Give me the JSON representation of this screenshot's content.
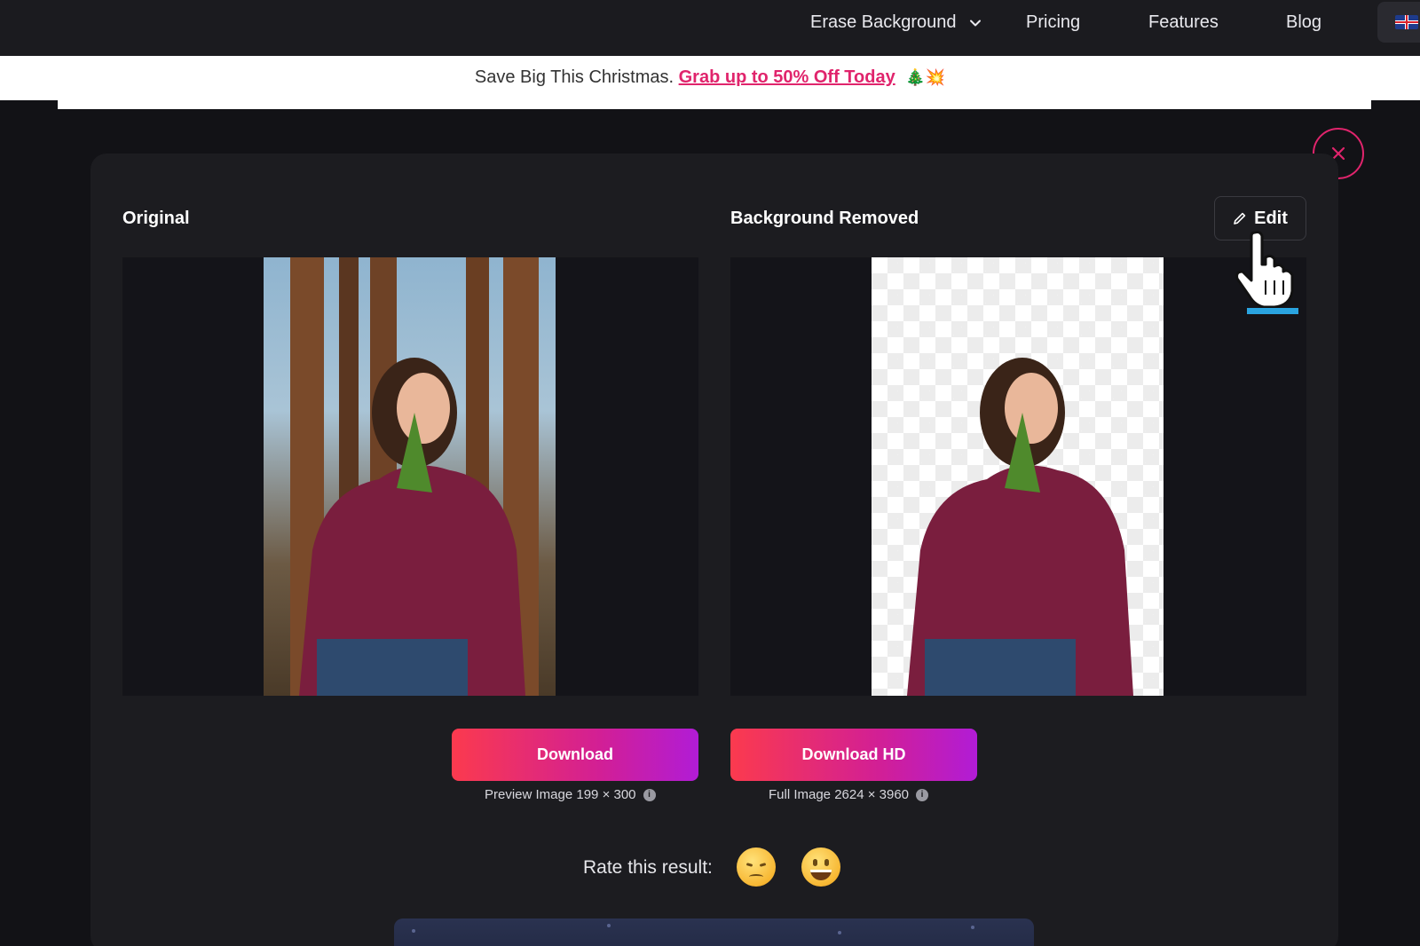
{
  "nav": {
    "erase_background": "Erase Background",
    "pricing": "Pricing",
    "features": "Features",
    "blog": "Blog",
    "language_flag": "uk-flag-icon"
  },
  "promo": {
    "text": "Save Big This Christmas.",
    "link": "Grab up to 50% Off Today",
    "emoji": "🎄💥"
  },
  "result": {
    "original_title": "Original",
    "removed_title": "Background Removed",
    "edit_label": "Edit"
  },
  "downloads": {
    "preview_label": "Download",
    "preview_meta": "Preview Image 199 × 300",
    "hd_label": "Download HD",
    "hd_meta": "Full Image 2624 × 3960"
  },
  "rating": {
    "label": "Rate this result:",
    "options": [
      "sad-face-icon",
      "happy-face-icon"
    ]
  },
  "colors": {
    "accent": "#e0246c",
    "gradient_start": "#fb3a4e",
    "gradient_end": "#b11cd6",
    "nav_bg": "#1b1b1f",
    "card_bg": "#1c1c20"
  }
}
